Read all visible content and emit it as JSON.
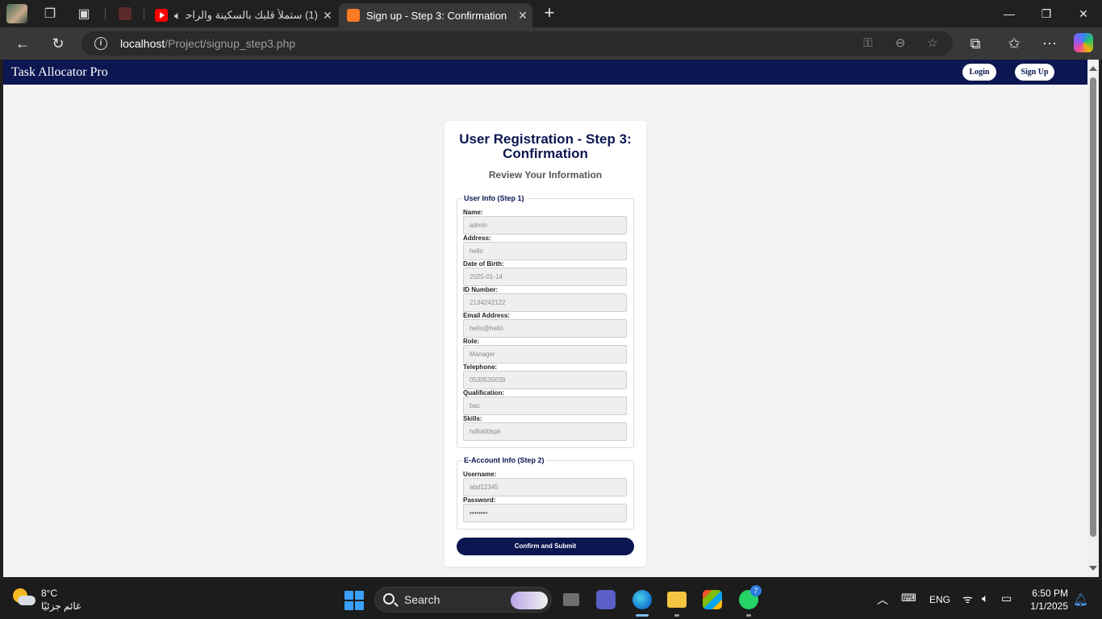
{
  "browser": {
    "tabs": [
      {
        "title": "(1) ستملأ قلبك بالسكينة والراحة",
        "active": false,
        "favicon": "youtube-icon"
      },
      {
        "title": "Sign up - Step 3: Confirmation",
        "active": true,
        "favicon": "xampp-icon"
      }
    ],
    "url_host": "localhost",
    "url_path": "/Project/signup_step3.php"
  },
  "app": {
    "brand": "Task Allocator Pro",
    "login_label": "Login",
    "signup_label": "Sign Up",
    "page_title": "User Registration - Step 3: Confirmation",
    "subtitle": "Review Your Information",
    "step1": {
      "legend": "User Info (Step 1)",
      "fields": [
        {
          "label": "Name:",
          "value": "admin"
        },
        {
          "label": "Address:",
          "value": "hello"
        },
        {
          "label": "Date of Birth:",
          "value": "2025-01-14"
        },
        {
          "label": "ID Number:",
          "value": "2134242122"
        },
        {
          "label": "Email Address:",
          "value": "hello@hello"
        },
        {
          "label": "Role:",
          "value": "Manager"
        },
        {
          "label": "Telephone:",
          "value": "0530535039"
        },
        {
          "label": "Qualification:",
          "value": "bac"
        },
        {
          "label": "Skills:",
          "value": "hdfokfdspk"
        }
      ]
    },
    "step2": {
      "legend": "E-Account Info (Step 2)",
      "fields": [
        {
          "label": "Username:",
          "value": "abd12345"
        },
        {
          "label": "Password:",
          "value": "••••••••"
        }
      ]
    },
    "submit_label": "Confirm and Submit",
    "colors": {
      "primary": "#0c1650",
      "background": "#f4f4f6"
    }
  },
  "taskbar": {
    "temperature": "8°C",
    "condition": "غائم جزئيًا",
    "search_label": "Search",
    "language": "ENG",
    "time": "6:50 PM",
    "date": "1/1/2025",
    "whatsapp_badge": "7"
  }
}
